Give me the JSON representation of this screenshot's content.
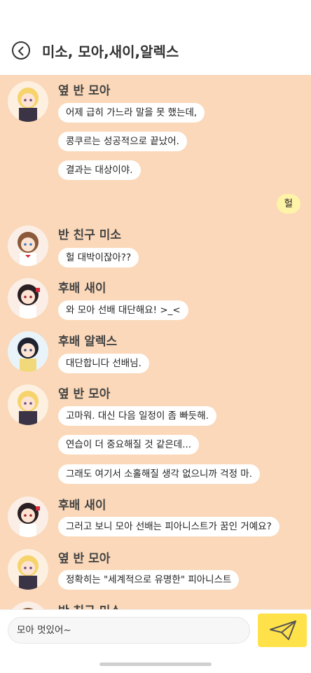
{
  "header": {
    "title": "미소, 모아,새이,알렉스",
    "back_icon": "chevron-left-icon"
  },
  "messages": [
    {
      "type": "sender",
      "text": "옆 반 모아",
      "avatar": "moa"
    },
    {
      "type": "bubble",
      "text": "어제 급히 가느라 말을 못 했는데,"
    },
    {
      "type": "bubble",
      "text": "콩쿠르는 성공적으로 끝났어."
    },
    {
      "type": "bubble",
      "text": "결과는 대상이야."
    },
    {
      "type": "mine",
      "text": "헐"
    },
    {
      "type": "sender",
      "text": "반 친구 미소",
      "avatar": "miso"
    },
    {
      "type": "bubble",
      "text": "헐 대박이잖아??"
    },
    {
      "type": "sender",
      "text": "후배 새이",
      "avatar": "saei"
    },
    {
      "type": "bubble",
      "text": "와 모아 선배 대단해요! >_<"
    },
    {
      "type": "sender",
      "text": "후배 알렉스",
      "avatar": "alex"
    },
    {
      "type": "bubble",
      "text": "대단합니다 선배님."
    },
    {
      "type": "sender",
      "text": "옆 반 모아",
      "avatar": "moa"
    },
    {
      "type": "bubble",
      "text": "고마워. 대신 다음 일정이 좀 빠듯해."
    },
    {
      "type": "bubble",
      "text": "연습이 더 중요해질 것 같은데..."
    },
    {
      "type": "bubble",
      "text": "그래도 여기서 소홀해질 생각 없으니까 걱정 마."
    },
    {
      "type": "sender",
      "text": "후배 새이",
      "avatar": "saei"
    },
    {
      "type": "bubble",
      "text": "그러고 보니 모아 선배는 피아니스트가 꿈인 거예요?"
    },
    {
      "type": "sender",
      "text": "옆 반 모아",
      "avatar": "moa"
    },
    {
      "type": "bubble",
      "text": "정확히는 \"세계적으로 유명한\" 피아니스트"
    },
    {
      "type": "sender",
      "text": "반 친구 미소",
      "avatar": "miso"
    }
  ],
  "input": {
    "value": "모아 멋있어~"
  },
  "send_icon": "paper-plane-icon",
  "colors": {
    "chat_bg": "#fad8b9",
    "my_bubble": "#fff3a8",
    "send_button": "#ffe24a"
  }
}
